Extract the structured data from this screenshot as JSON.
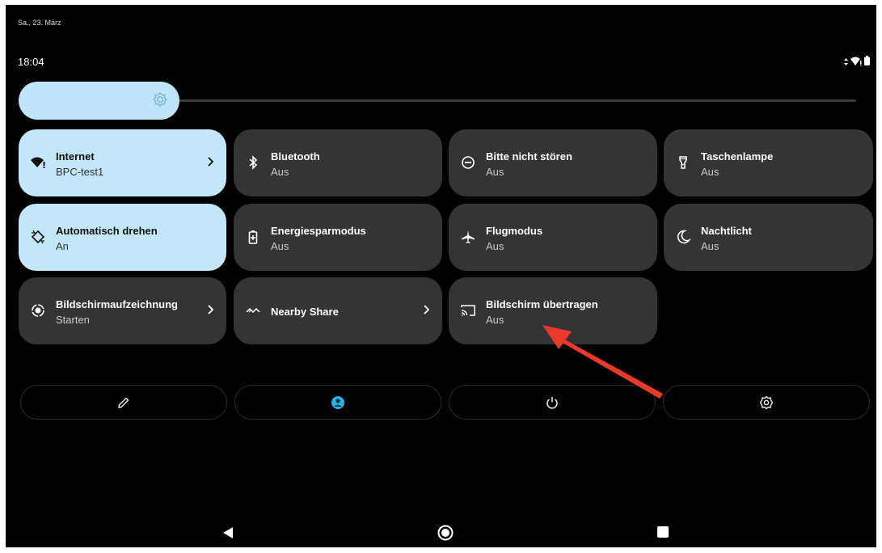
{
  "status": {
    "date": "Sa., 23. März",
    "time": "18:04"
  },
  "tiles": [
    {
      "label": "Internet",
      "sub": "BPC-test1",
      "icon": "wifi-icon"
    },
    {
      "label": "Bluetooth",
      "sub": "Aus",
      "icon": "bluetooth-icon"
    },
    {
      "label": "Bitte nicht stören",
      "sub": "Aus",
      "icon": "do-not-disturb-icon"
    },
    {
      "label": "Taschenlampe",
      "sub": "Aus",
      "icon": "flashlight-icon"
    },
    {
      "label": "Automatisch drehen",
      "sub": "An",
      "icon": "auto-rotate-icon"
    },
    {
      "label": "Energiesparmodus",
      "sub": "Aus",
      "icon": "battery-saver-icon"
    },
    {
      "label": "Flugmodus",
      "sub": "Aus",
      "icon": "airplane-icon"
    },
    {
      "label": "Nachtlicht",
      "sub": "Aus",
      "icon": "moon-icon"
    },
    {
      "label": "Bildschirmaufzeichnung",
      "sub": "Starten",
      "icon": "screen-record-icon"
    },
    {
      "label": "Nearby Share",
      "icon": "nearby-share-icon"
    },
    {
      "label": "Bildschirm übertragen",
      "sub": "Aus",
      "icon": "cast-icon"
    }
  ],
  "brightness": {
    "level": 0.2,
    "icon": "brightness-icon"
  },
  "bottom_actions": [
    "pencil-icon",
    "user-icon",
    "power-icon",
    "gear-icon"
  ],
  "nav": [
    "back-icon",
    "home-icon",
    "recents-icon"
  ],
  "colors": {
    "active_tile": "#c2e7f9",
    "inactive_tile": "#333435",
    "background": "#000000",
    "annotation_arrow": "#e8392b"
  }
}
